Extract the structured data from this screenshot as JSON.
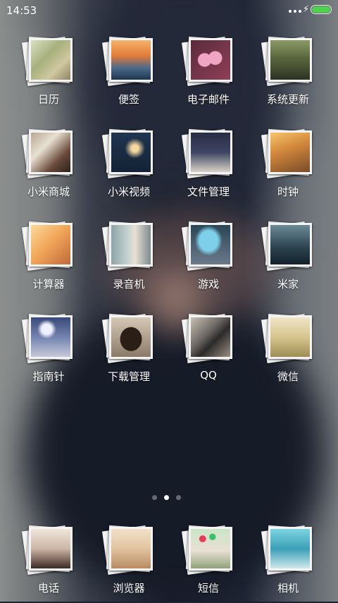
{
  "status_bar": {
    "time": "14:53",
    "bolt": "⚡"
  },
  "grid_apps": [
    {
      "label": "日历",
      "photo": "p-cal"
    },
    {
      "label": "便签",
      "photo": "p-note"
    },
    {
      "label": "电子邮件",
      "photo": "p-mail"
    },
    {
      "label": "系统更新",
      "photo": "p-update"
    },
    {
      "label": "小米商城",
      "photo": "p-mall"
    },
    {
      "label": "小米视频",
      "photo": "p-video"
    },
    {
      "label": "文件管理",
      "photo": "p-file"
    },
    {
      "label": "时钟",
      "photo": "p-clock"
    },
    {
      "label": "计算器",
      "photo": "p-calc"
    },
    {
      "label": "录音机",
      "photo": "p-rec"
    },
    {
      "label": "游戏",
      "photo": "p-game"
    },
    {
      "label": "米家",
      "photo": "p-mijia"
    },
    {
      "label": "指南针",
      "photo": "p-compass"
    },
    {
      "label": "下载管理",
      "photo": "p-dl"
    },
    {
      "label": "QQ",
      "photo": "p-qq"
    },
    {
      "label": "微信",
      "photo": "p-wx"
    }
  ],
  "dock_apps": [
    {
      "label": "电话",
      "photo": "p-phone"
    },
    {
      "label": "浏览器",
      "photo": "p-browser"
    },
    {
      "label": "短信",
      "photo": "p-sms"
    },
    {
      "label": "相机",
      "photo": "p-cam"
    }
  ],
  "pager": {
    "count": 3,
    "active": 2
  },
  "colors": {
    "battery": "#4fd34f",
    "label": "#ffffff"
  }
}
